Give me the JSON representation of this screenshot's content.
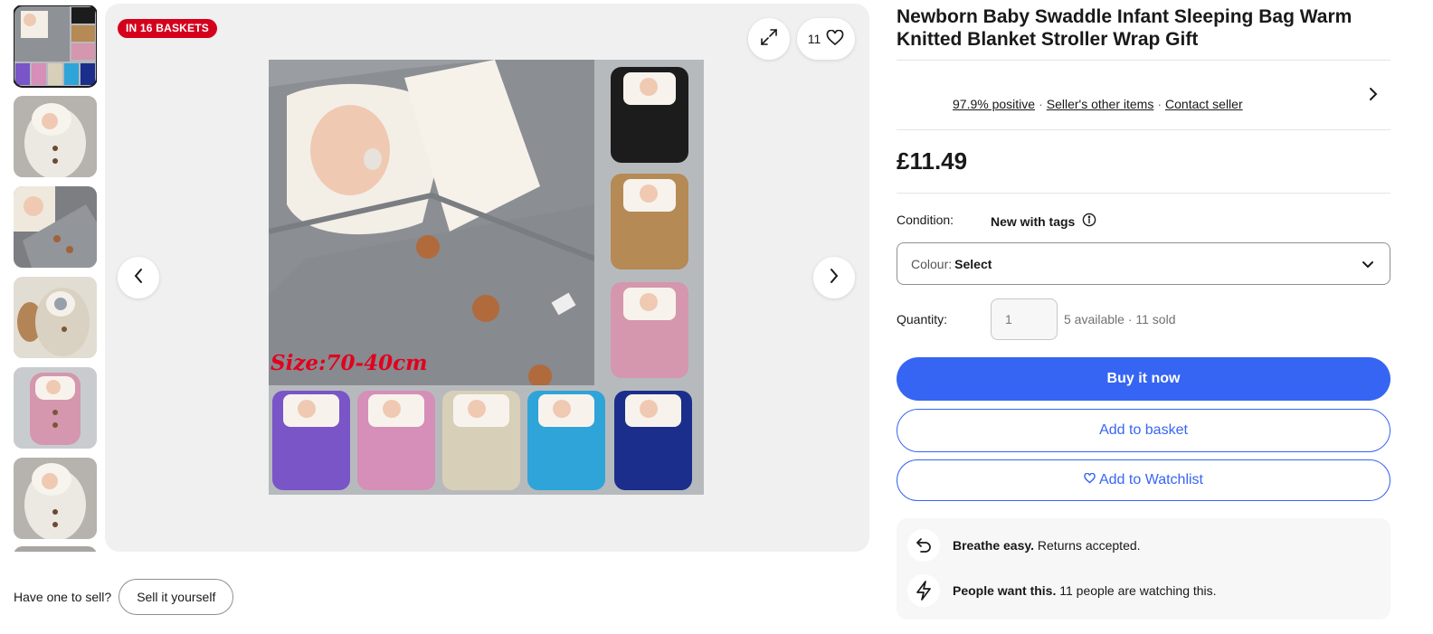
{
  "badge": "IN 16 BASKETS",
  "watch_count": "11",
  "image_overlay_text": "Size:70-40cm",
  "sell": {
    "prompt": "Have one to sell?",
    "button": "Sell it yourself"
  },
  "product": {
    "title": "Newborn Baby Swaddle Infant Sleeping Bag Warm Knitted Blanket Stroller Wrap Gift",
    "price": "£11.49"
  },
  "seller": {
    "feedback": "97.9% positive",
    "other_items": "Seller's other items",
    "contact": "Contact seller",
    "separator": "·"
  },
  "condition": {
    "label": "Condition:",
    "value": "New with tags"
  },
  "variation": {
    "label": "Colour:",
    "value": "Select"
  },
  "quantity": {
    "label": "Quantity:",
    "placeholder": "1",
    "availability": "5 available · 11 sold"
  },
  "actions": {
    "buy_now": "Buy it now",
    "add_to_basket": "Add to basket",
    "add_to_watchlist": "Add to Watchlist"
  },
  "highlights": [
    {
      "icon": "return-icon",
      "bold": "Breathe easy.",
      "text": " Returns accepted."
    },
    {
      "icon": "lightning-icon",
      "bold": "People want this.",
      "text": " 11 people are watching this."
    }
  ],
  "colors": {
    "badge_red": "#d5001c",
    "primary_blue": "#3665f3",
    "stage_bg": "#f0f0f0",
    "swaddle_grey": "#8e9196",
    "swaddle_colours": [
      "#1c1c1c",
      "#b58a55",
      "#d497ad",
      "#7a55c8",
      "#d58fb8",
      "#d8cfb9",
      "#2fa4d8",
      "#1b2e8c"
    ]
  },
  "thumbnails": [
    "main-collage",
    "white-hooded",
    "grey-knit",
    "beige-knit",
    "pink-knit",
    "white-hooded-2",
    "partial"
  ]
}
